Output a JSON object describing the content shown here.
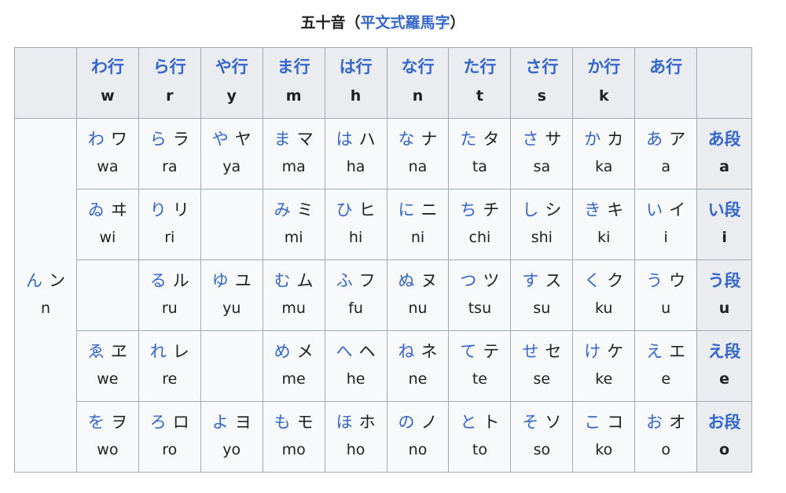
{
  "caption": {
    "prefix": "五十音（",
    "link": "平文式羅馬字",
    "suffix": "）"
  },
  "columns": [
    {
      "kana": "わ行",
      "roma": "w"
    },
    {
      "kana": "ら行",
      "roma": "r"
    },
    {
      "kana": "や行",
      "roma": "y"
    },
    {
      "kana": "ま行",
      "roma": "m"
    },
    {
      "kana": "は行",
      "roma": "h"
    },
    {
      "kana": "な行",
      "roma": "n"
    },
    {
      "kana": "た行",
      "roma": "t"
    },
    {
      "kana": "さ行",
      "roma": "s"
    },
    {
      "kana": "か行",
      "roma": "k"
    },
    {
      "kana": "あ行",
      "roma": ""
    }
  ],
  "n_cell": {
    "hira": "ん",
    "kata": "ン",
    "roma": "n"
  },
  "rows": [
    {
      "dan": {
        "kana": "あ段",
        "roma": "a"
      },
      "cells": [
        {
          "hira": "わ",
          "kata": "ワ",
          "roma": "wa"
        },
        {
          "hira": "ら",
          "kata": "ラ",
          "roma": "ra"
        },
        {
          "hira": "や",
          "kata": "ヤ",
          "roma": "ya"
        },
        {
          "hira": "ま",
          "kata": "マ",
          "roma": "ma"
        },
        {
          "hira": "は",
          "kata": "ハ",
          "roma": "ha"
        },
        {
          "hira": "な",
          "kata": "ナ",
          "roma": "na"
        },
        {
          "hira": "た",
          "kata": "タ",
          "roma": "ta"
        },
        {
          "hira": "さ",
          "kata": "サ",
          "roma": "sa"
        },
        {
          "hira": "か",
          "kata": "カ",
          "roma": "ka"
        },
        {
          "hira": "あ",
          "kata": "ア",
          "roma": "a"
        }
      ]
    },
    {
      "dan": {
        "kana": "い段",
        "roma": "i"
      },
      "cells": [
        {
          "hira": "ゐ",
          "kata": "ヰ",
          "roma": "wi"
        },
        {
          "hira": "り",
          "kata": "リ",
          "roma": "ri"
        },
        null,
        {
          "hira": "み",
          "kata": "ミ",
          "roma": "mi"
        },
        {
          "hira": "ひ",
          "kata": "ヒ",
          "roma": "hi"
        },
        {
          "hira": "に",
          "kata": "ニ",
          "roma": "ni"
        },
        {
          "hira": "ち",
          "kata": "チ",
          "roma": "chi"
        },
        {
          "hira": "し",
          "kata": "シ",
          "roma": "shi"
        },
        {
          "hira": "き",
          "kata": "キ",
          "roma": "ki"
        },
        {
          "hira": "い",
          "kata": "イ",
          "roma": "i"
        }
      ]
    },
    {
      "dan": {
        "kana": "う段",
        "roma": "u"
      },
      "cells": [
        null,
        {
          "hira": "る",
          "kata": "ル",
          "roma": "ru"
        },
        {
          "hira": "ゆ",
          "kata": "ユ",
          "roma": "yu"
        },
        {
          "hira": "む",
          "kata": "ム",
          "roma": "mu"
        },
        {
          "hira": "ふ",
          "kata": "フ",
          "roma": "fu"
        },
        {
          "hira": "ぬ",
          "kata": "ヌ",
          "roma": "nu"
        },
        {
          "hira": "つ",
          "kata": "ツ",
          "roma": "tsu"
        },
        {
          "hira": "す",
          "kata": "ス",
          "roma": "su"
        },
        {
          "hira": "く",
          "kata": "ク",
          "roma": "ku"
        },
        {
          "hira": "う",
          "kata": "ウ",
          "roma": "u"
        }
      ]
    },
    {
      "dan": {
        "kana": "え段",
        "roma": "e"
      },
      "cells": [
        {
          "hira": "ゑ",
          "kata": "ヱ",
          "roma": "we"
        },
        {
          "hira": "れ",
          "kata": "レ",
          "roma": "re"
        },
        null,
        {
          "hira": "め",
          "kata": "メ",
          "roma": "me"
        },
        {
          "hira": "へ",
          "kata": "ヘ",
          "roma": "he"
        },
        {
          "hira": "ね",
          "kata": "ネ",
          "roma": "ne"
        },
        {
          "hira": "て",
          "kata": "テ",
          "roma": "te"
        },
        {
          "hira": "せ",
          "kata": "セ",
          "roma": "se"
        },
        {
          "hira": "け",
          "kata": "ケ",
          "roma": "ke"
        },
        {
          "hira": "え",
          "kata": "エ",
          "roma": "e"
        }
      ]
    },
    {
      "dan": {
        "kana": "お段",
        "roma": "o"
      },
      "cells": [
        {
          "hira": "を",
          "kata": "ヲ",
          "roma": "wo"
        },
        {
          "hira": "ろ",
          "kata": "ロ",
          "roma": "ro"
        },
        {
          "hira": "よ",
          "kata": "ヨ",
          "roma": "yo"
        },
        {
          "hira": "も",
          "kata": "モ",
          "roma": "mo"
        },
        {
          "hira": "ほ",
          "kata": "ホ",
          "roma": "ho"
        },
        {
          "hira": "の",
          "kata": "ノ",
          "roma": "no"
        },
        {
          "hira": "と",
          "kata": "ト",
          "roma": "to"
        },
        {
          "hira": "そ",
          "kata": "ソ",
          "roma": "so"
        },
        {
          "hira": "こ",
          "kata": "コ",
          "roma": "ko"
        },
        {
          "hira": "お",
          "kata": "オ",
          "roma": "o"
        }
      ]
    }
  ],
  "colors": {
    "link": "#3366cc",
    "text": "#202122",
    "header_bg": "#eaecf0",
    "cell_bg": "#f8f9fa",
    "border": "#a2a9b1"
  }
}
